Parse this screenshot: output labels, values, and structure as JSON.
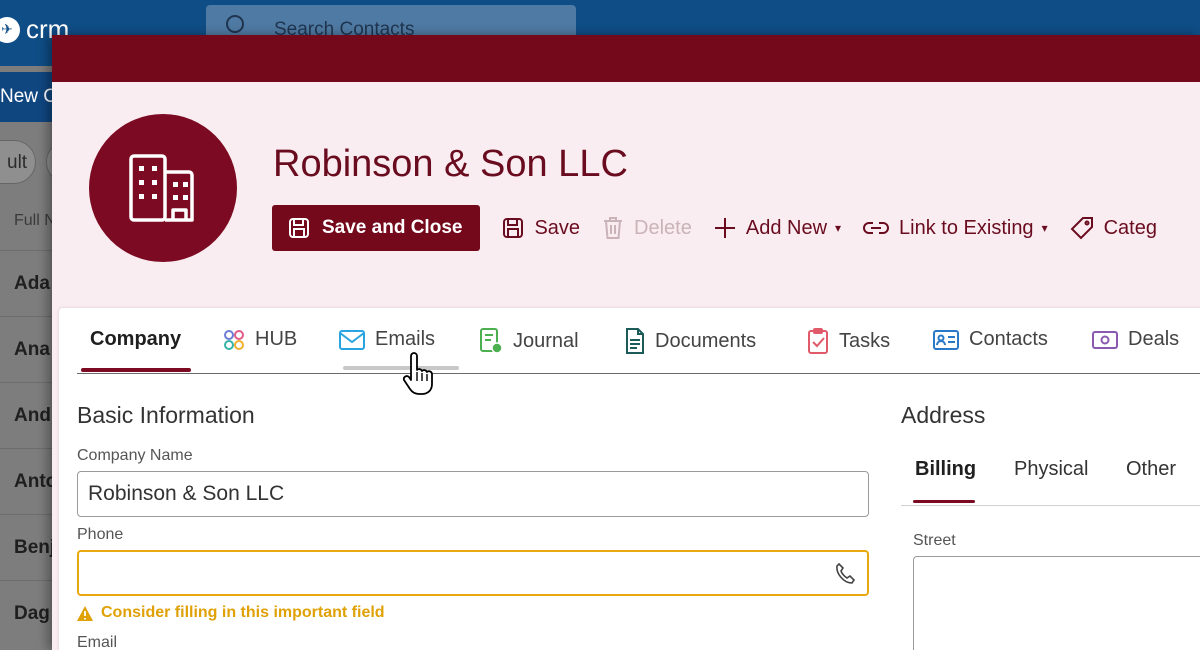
{
  "background": {
    "logo_text": "crm",
    "search_placeholder": "Search Contacts",
    "new_button_label": "New C",
    "filter_label": "ult",
    "column_header": "Full N",
    "rows": [
      "Ada",
      "Ana",
      "And",
      "Anto",
      "Benj",
      "Dag"
    ]
  },
  "dialog": {
    "title": "Robinson & Son LLC",
    "avatar_icon": "building-icon",
    "commands": {
      "save_and_close": "Save and Close",
      "save": "Save",
      "delete": "Delete",
      "add_new": "Add New",
      "link_to_existing": "Link to Existing",
      "categories": "Categ"
    },
    "tabs": [
      {
        "label": "Company",
        "icon": "none"
      },
      {
        "label": "HUB",
        "icon": "hub-icon"
      },
      {
        "label": "Emails",
        "icon": "envelope-icon"
      },
      {
        "label": "Journal",
        "icon": "journal-icon"
      },
      {
        "label": "Documents",
        "icon": "document-icon"
      },
      {
        "label": "Tasks",
        "icon": "clipboard-check-icon"
      },
      {
        "label": "Contacts",
        "icon": "contact-card-icon"
      },
      {
        "label": "Deals",
        "icon": "money-icon"
      }
    ],
    "basic_info": {
      "section_title": "Basic Information",
      "company_name_label": "Company Name",
      "company_name_value": "Robinson & Son LLC",
      "phone_label": "Phone",
      "phone_value": "",
      "phone_warning": "Consider filling in this important field",
      "email_label": "Email"
    },
    "address": {
      "section_title": "Address",
      "tabs": [
        "Billing",
        "Physical",
        "Other"
      ],
      "active_tab": "Billing",
      "street_label": "Street"
    },
    "colors": {
      "primary": "#75091c",
      "header_bg": "#faedf1",
      "warning": "#e7a90f"
    }
  }
}
